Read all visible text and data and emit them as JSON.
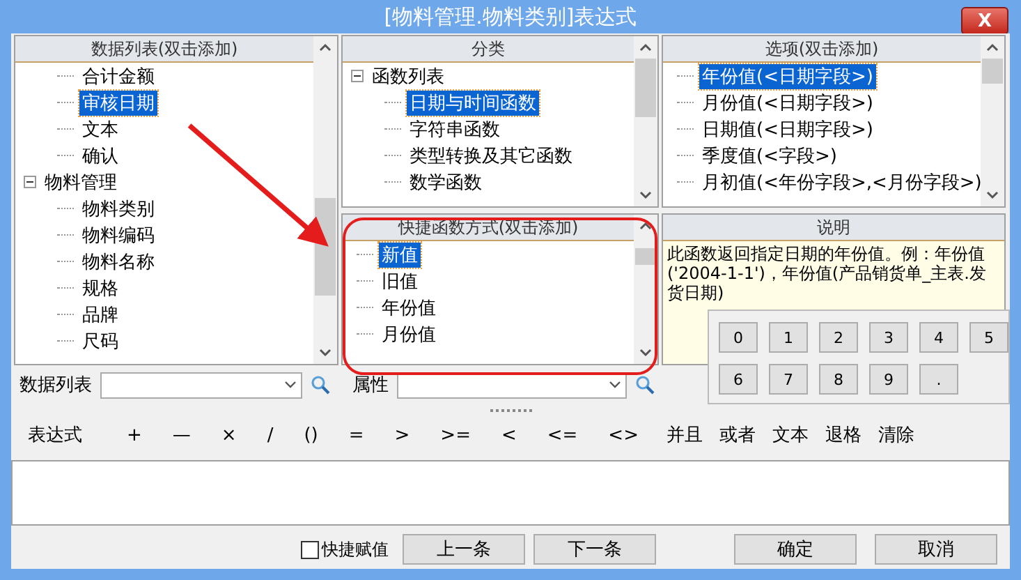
{
  "window": {
    "title": "[物料管理.物料类别]表达式",
    "close_label": "X"
  },
  "data_list": {
    "title": "数据列表(双击添加)",
    "items": [
      {
        "label": "合计金额",
        "selected": false
      },
      {
        "label": "审核日期",
        "selected": true
      },
      {
        "label": "文本",
        "selected": false
      },
      {
        "label": "确认",
        "selected": false
      },
      {
        "label": "物料管理",
        "selected": false,
        "expanded": true,
        "children": [
          {
            "label": "物料类别",
            "selected": false
          },
          {
            "label": "物料编码",
            "selected": false
          },
          {
            "label": "物料名称",
            "selected": false
          },
          {
            "label": "规格",
            "selected": false
          },
          {
            "label": "品牌",
            "selected": false
          },
          {
            "label": "尺码",
            "selected": false
          }
        ]
      }
    ]
  },
  "category": {
    "title": "分类",
    "items": [
      {
        "label": "函数列表",
        "selected": false,
        "expanded": true,
        "children": [
          {
            "label": "日期与时间函数",
            "selected": true
          },
          {
            "label": "字符串函数",
            "selected": false
          },
          {
            "label": "类型转换及其它函数",
            "selected": false
          },
          {
            "label": "数学函数",
            "selected": false
          }
        ]
      }
    ]
  },
  "options": {
    "title": "选项(双击添加)",
    "items": [
      {
        "label": "年份值(<日期字段>)",
        "selected": true
      },
      {
        "label": "月份值(<日期字段>)",
        "selected": false
      },
      {
        "label": "日期值(<日期字段>)",
        "selected": false
      },
      {
        "label": "季度值(<字段>)",
        "selected": false
      },
      {
        "label": "月初值(<年份字段>,<月份字段>)",
        "selected": false
      }
    ]
  },
  "quick_functions": {
    "title": "快捷函数方式(双击添加)",
    "items": [
      {
        "label": "新值",
        "selected": true
      },
      {
        "label": "旧值",
        "selected": false
      },
      {
        "label": "年份值",
        "selected": false
      },
      {
        "label": "月份值",
        "selected": false
      }
    ]
  },
  "description": {
    "title": "说明",
    "text": "此函数返回指定日期的年份值。例：年份值('2004-1-1')，年份值(产品销货单_主表.发货日期)"
  },
  "numpad": [
    "0",
    "1",
    "2",
    "3",
    "4",
    "5",
    "6",
    "7",
    "8",
    "9",
    "."
  ],
  "filters": [
    {
      "label": "数据列表"
    },
    {
      "label": "属性"
    }
  ],
  "toolbar": {
    "label": "表达式",
    "operators": [
      "+",
      "—",
      "×",
      "/",
      "()",
      "=",
      ">",
      ">=",
      "<",
      "<=",
      "<>",
      "并且",
      "或者",
      "文本",
      "退格",
      "清除"
    ]
  },
  "quick_assign": {
    "label": "快捷赋值",
    "checked": false
  },
  "nav_buttons": [
    "上一条",
    "下一条"
  ],
  "dialog_buttons": [
    "确定",
    "取消"
  ]
}
